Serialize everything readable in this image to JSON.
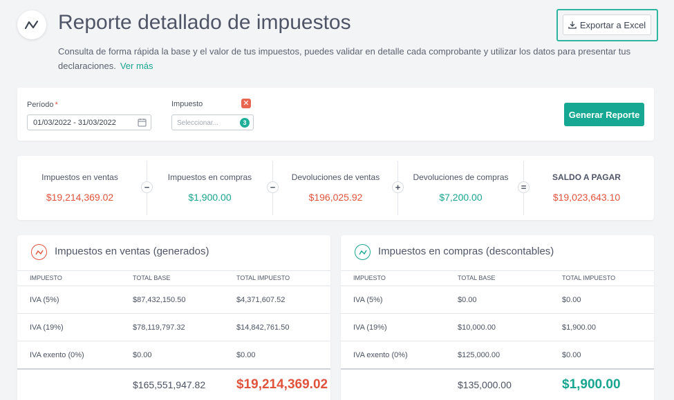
{
  "header": {
    "title": "Reporte detallado de impuestos",
    "description": "Consulta de forma rápida la base y el valor de tus impuestos, puedes validar en detalle cada comprobante y utilizar los datos para presentar tus declaraciones.",
    "more_link": "Ver más",
    "export_label": "Exportar a Excel"
  },
  "filters": {
    "period_label": "Período",
    "period_required": "*",
    "period_value": "01/03/2022 - 31/03/2022",
    "tax_label": "Impuesto",
    "tax_placeholder": "Seleccionar...",
    "tax_count": "3",
    "clear_symbol": "✕",
    "generate_label": "Generar Reporte"
  },
  "summary": {
    "items": [
      {
        "label": "Impuestos en ventas",
        "value": "$19,214,369.02",
        "color": "#e0533c"
      },
      {
        "label": "Impuestos en compras",
        "value": "$1,900.00",
        "color": "#18a58f"
      },
      {
        "label": "Devoluciones de ventas",
        "value": "$196,025.92",
        "color": "#e0533c"
      },
      {
        "label": "Devoluciones de compras",
        "value": "$7,200.00",
        "color": "#18a58f"
      },
      {
        "label": "SALDO A PAGAR",
        "value": "$19,023,643.10",
        "color": "#e0533c"
      }
    ],
    "operators": [
      "−",
      "−",
      "+",
      "="
    ]
  },
  "sales_table": {
    "title": "Impuestos en ventas (generados)",
    "columns": [
      "IMPUESTO",
      "TOTAL BASE",
      "TOTAL IMPUESTO"
    ],
    "rows": [
      [
        "IVA (5%)",
        "$87,432,150.50",
        "$4,371,607.52"
      ],
      [
        "IVA (19%)",
        "$78,119,797.32",
        "$14,842,761.50"
      ],
      [
        "IVA exento (0%)",
        "$0.00",
        "$0.00"
      ]
    ],
    "total_base": "$165,551,947.82",
    "total_tax": "$19,214,369.02"
  },
  "purchases_table": {
    "title": "Impuestos en compras (descontables)",
    "columns": [
      "IMPUESTO",
      "TOTAL BASE",
      "TOTAL IMPUESTO"
    ],
    "rows": [
      [
        "IVA (5%)",
        "$0.00",
        "$0.00"
      ],
      [
        "IVA (19%)",
        "$10,000.00",
        "$1,900.00"
      ],
      [
        "IVA exento (0%)",
        "$125,000.00",
        "$0.00"
      ]
    ],
    "total_base": "$135,000.00",
    "total_tax": "$1,900.00"
  },
  "colors": {
    "accent": "#16a892",
    "red": "#e0533c",
    "teal": "#18a58f"
  },
  "icons": {
    "logo": "trend-icon",
    "download": "download-icon",
    "calendar": "calendar-icon"
  }
}
